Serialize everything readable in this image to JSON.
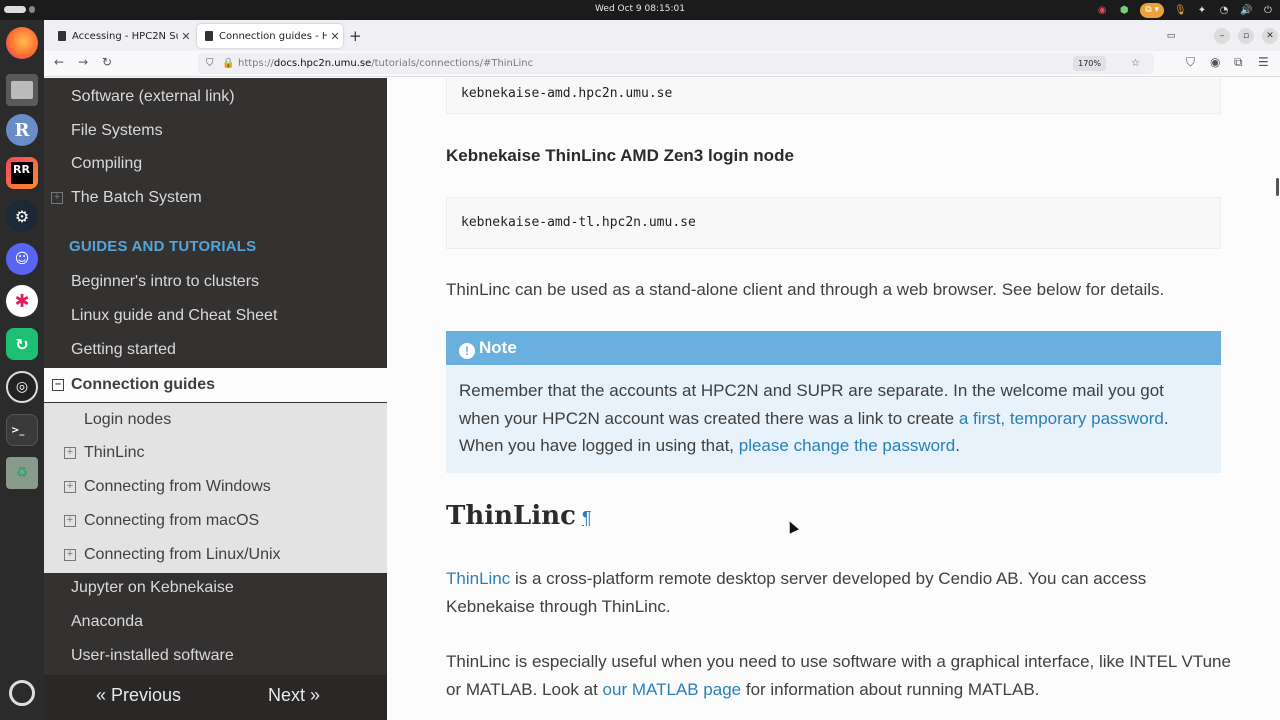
{
  "system": {
    "clock": "Wed Oct 9  08:15:01"
  },
  "dock": {
    "icons": [
      "firefox-icon",
      "files-icon",
      "r-icon",
      "rustrover-icon",
      "steam-icon",
      "discord-icon",
      "slack-icon",
      "app-icon",
      "obs-icon",
      "terminal-icon",
      "trash-icon",
      "ubuntu-icon"
    ]
  },
  "browser": {
    "tabs": [
      {
        "label": "Accessing - HPC2N Suppo"
      },
      {
        "label": "Connection guides - HPC2"
      }
    ],
    "url_prefix": "https://",
    "url_host": "docs.hpc2n.umu.se",
    "url_path": "/tutorials/connections/#ThinLinc",
    "zoom": "170%"
  },
  "sidebar": {
    "items_top": [
      {
        "label": "Software (external link)"
      },
      {
        "label": "File Systems"
      },
      {
        "label": "Compiling"
      },
      {
        "label": "The Batch System"
      }
    ],
    "caption": "GUIDES AND TUTORIALS",
    "items_guides": [
      {
        "label": "Beginner's intro to clusters"
      },
      {
        "label": "Linux guide and Cheat Sheet"
      },
      {
        "label": "Getting started"
      }
    ],
    "current": "Connection guides",
    "sub_items": [
      {
        "label": "Login nodes"
      },
      {
        "label": "ThinLinc"
      },
      {
        "label": "Connecting from Windows"
      },
      {
        "label": "Connecting from macOS"
      },
      {
        "label": "Connecting from Linux/Unix"
      }
    ],
    "items_bottom": [
      {
        "label": "Jupyter on Kebnekaise"
      },
      {
        "label": "Anaconda"
      },
      {
        "label": "User-installed software"
      }
    ],
    "prev": "« Previous",
    "next": "Next »"
  },
  "content": {
    "code1": "kebnekaise-amd.hpc2n.umu.se",
    "heading_tl": "Kebnekaise ThinLinc AMD Zen3 login node",
    "code2": "kebnekaise-amd-tl.hpc2n.umu.se",
    "para1": "ThinLinc can be used as a stand-alone client and through a web browser. See below for details.",
    "note_title": "Note",
    "note_text1": "Remember that the accounts at HPC2N and SUPR are separate. In the welcome mail you got when your HPC2N account was created there was a link to create ",
    "note_link1": "a first, temporary password",
    "note_text2": ". When you have logged in using that, ",
    "note_link2": "please change the password",
    "note_text3": ".",
    "section_title": "ThinLinc",
    "pilcrow": "¶",
    "p2_link": "ThinLinc",
    "p2_text": " is a cross-platform remote desktop server developed by Cendio AB. You can access Kebnekaise through ThinLinc.",
    "p3_text1": "ThinLinc is especially useful when you need to use software with a graphical interface, like INTEL VTune or MATLAB. Look at ",
    "p3_link": "our MATLAB page",
    "p3_text2": " for information about running MATLAB."
  }
}
